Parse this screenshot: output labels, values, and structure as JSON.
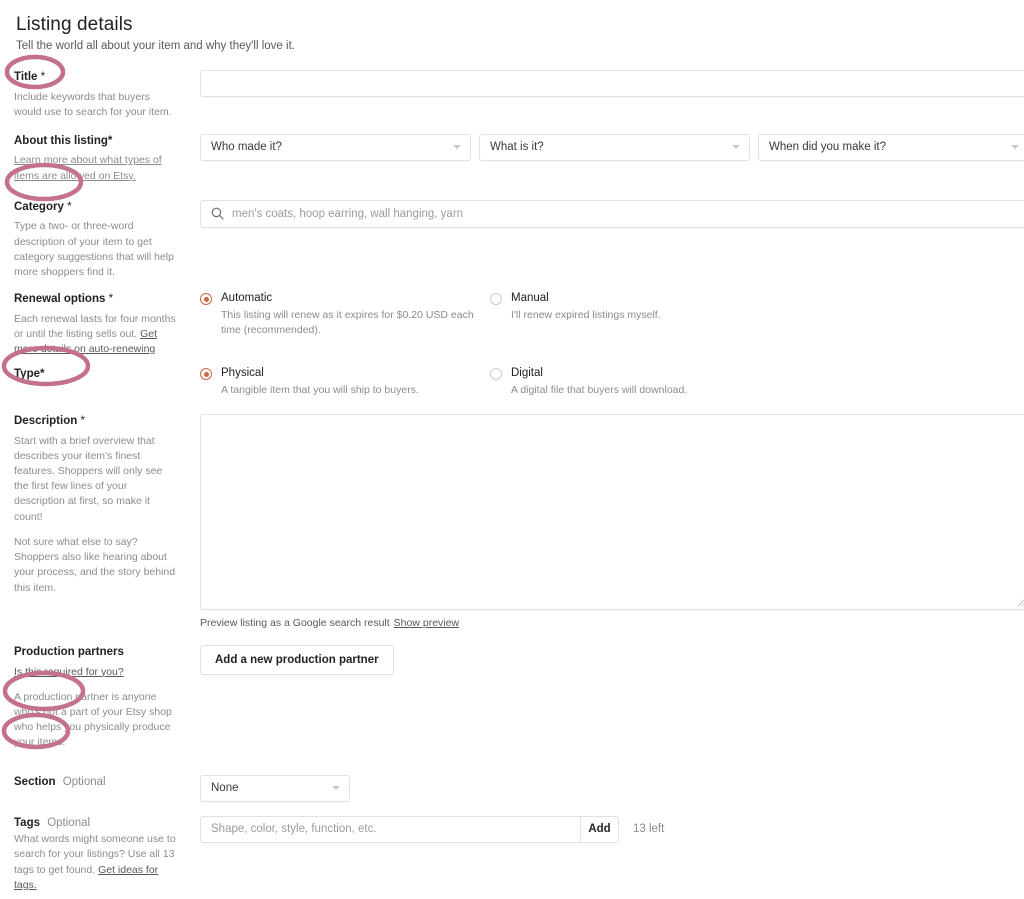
{
  "header": {
    "title": "Listing details",
    "subtitle": "Tell the world all about your item and why they'll love it."
  },
  "sections": {
    "title": {
      "label": "Title",
      "required_mark": "*",
      "help": "Include keywords that buyers would use to search for your item.",
      "input_value": "",
      "input_placeholder": ""
    },
    "about": {
      "label": "About this listing*",
      "help_link": "Learn more about what types of items are allowed on Etsy.",
      "dropdowns": [
        {
          "name": "who-made-it",
          "value": "Who made it?"
        },
        {
          "name": "what-is-it",
          "value": "What is it?"
        },
        {
          "name": "when-made",
          "value": "When did you make it?"
        }
      ]
    },
    "category": {
      "label": "Category",
      "required_mark": "*",
      "help": "Type a two- or three-word description of your item to get category suggestions that will help more shoppers find it.",
      "search_placeholder": "men's coats, hoop earring, wall hanging, yarn",
      "search_icon": "search-icon"
    },
    "renewal": {
      "label": "Renewal options",
      "required_mark": "*",
      "help_prefix": "Each renewal lasts for four months or until the listing sells out. ",
      "help_link": "Get more details on auto-renewing",
      "options": [
        {
          "id": "automatic",
          "label": "Automatic",
          "desc": "This listing will renew as it expires for $0.20 USD each time (recommended).",
          "selected": true
        },
        {
          "id": "manual",
          "label": "Manual",
          "desc": "I'll renew expired listings myself.",
          "selected": false
        }
      ]
    },
    "type": {
      "label": "Type*",
      "options": [
        {
          "id": "physical",
          "label": "Physical",
          "desc": "A tangible item that you will ship to buyers.",
          "selected": true
        },
        {
          "id": "digital",
          "label": "Digital",
          "desc": "A digital file that buyers will download.",
          "selected": false
        }
      ]
    },
    "description": {
      "label": "Description",
      "required_mark": "*",
      "help_1": "Start with a brief overview that describes your item's finest features. Shoppers will only see the first few lines of your description at first, so make it count!",
      "help_2": "Not sure what else to say? Shoppers also like hearing about your process, and the story behind this item.",
      "textarea_value": "",
      "preview_text": "Preview listing as a Google search result",
      "preview_link": "Show preview"
    },
    "production_partners": {
      "label": "Production partners",
      "help_link": "Is this required for you?",
      "help": "A production partner is anyone who's not a part of your Etsy shop who helps you physically produce your items.",
      "button_label": "Add a new production partner"
    },
    "section": {
      "label": "Section",
      "optional_text": "Optional",
      "dropdown_value": "None"
    },
    "tags": {
      "label": "Tags",
      "optional_text": "Optional",
      "help_prefix": "What words might someone use to search for your listings? Use all 13 tags to get found. ",
      "help_link": "Get ideas for tags.",
      "input_placeholder": "Shape, color, style, function, etc.",
      "add_label": "Add",
      "remaining": "13 left"
    }
  },
  "annotations": {
    "color": "#c4708f",
    "circled_labels": [
      "Title",
      "Category",
      "Description",
      "Section",
      "Tags"
    ]
  },
  "colors": {
    "accent_radio": "#cd6745",
    "annotation_pink": "#c4708f",
    "border": "#e1e3df",
    "text": "#222222",
    "muted": "#8c8c8c"
  }
}
